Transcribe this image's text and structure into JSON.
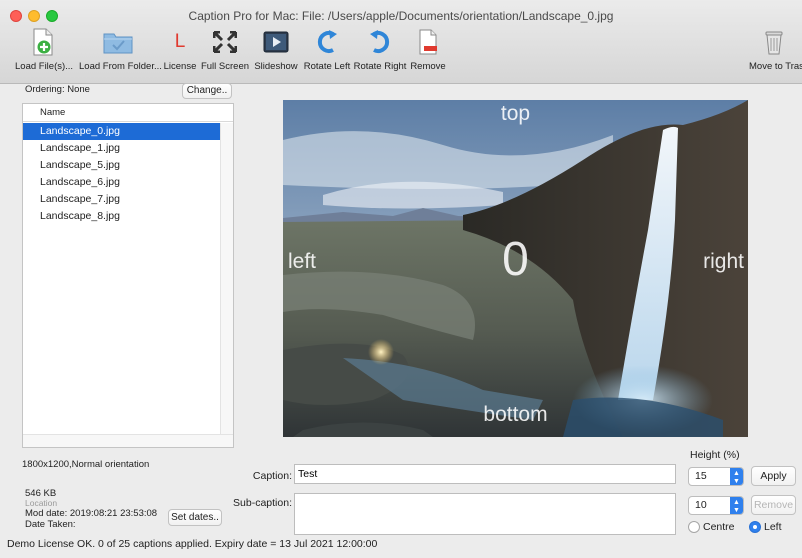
{
  "window": {
    "title": "Caption Pro for Mac: File: /Users/apple/Documents/orientation/Landscape_0.jpg"
  },
  "toolbar": {
    "load_files": "Load File(s)...",
    "load_folder": "Load From Folder...",
    "license": "License",
    "full_screen": "Full Screen",
    "slideshow": "Slideshow",
    "rotate_left": "Rotate Left",
    "rotate_right": "Rotate Right",
    "remove": "Remove",
    "move_to_trash": "Move to Tras"
  },
  "sidebar": {
    "ordering_label": "Ordering: None",
    "change_button": "Change..",
    "list_header": "Name",
    "files": [
      "Landscape_0.jpg",
      "Landscape_1.jpg",
      "Landscape_5.jpg",
      "Landscape_6.jpg",
      "Landscape_7.jpg",
      "Landscape_8.jpg"
    ],
    "selected_index": 0
  },
  "details": {
    "dimensions": "1800x1200,Normal orientation",
    "size": "546 KB",
    "location_label": "Location",
    "mod_date": "Mod date: 2019:08:21 23:53:08",
    "date_taken": "Date Taken:",
    "set_dates_button": "Set dates.."
  },
  "preview": {
    "top": "top",
    "bottom": "bottom",
    "left": "left",
    "right": "right",
    "center": "0"
  },
  "caption": {
    "caption_label": "Caption:",
    "caption_value": "Test",
    "subcaption_label": "Sub-caption:",
    "subcaption_value": "",
    "height_label": "Height (%)",
    "height_value": "15",
    "sub_height_value": "10",
    "apply_button": "Apply",
    "remove_button": "Remove",
    "centre_label": "Centre",
    "left_label": "Left",
    "alignment_selected": "Left"
  },
  "status": {
    "text": "Demo License OK. 0 of 25 captions applied.  Expiry date = 13 Jul 2021 12:00:00"
  },
  "colors": {
    "selection": "#1d6bd6",
    "accent": "#2f80ed",
    "license_red": "#e03a2f"
  },
  "icons": [
    "add-file-icon",
    "folder-icon",
    "license-icon",
    "full-screen-icon",
    "slideshow-icon",
    "rotate-left-icon",
    "rotate-right-icon",
    "remove-file-icon",
    "trash-icon"
  ]
}
